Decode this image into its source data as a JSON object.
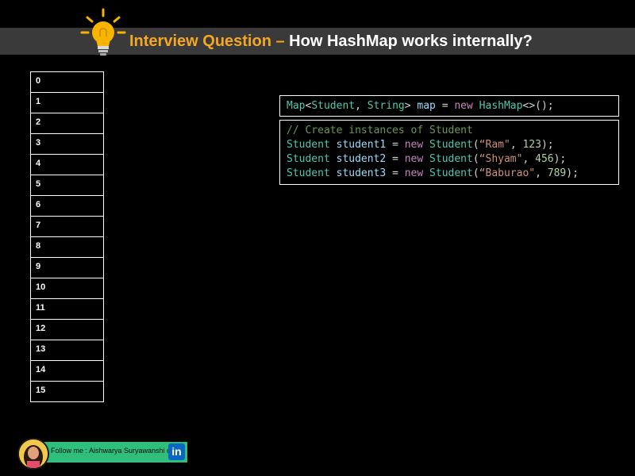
{
  "header": {
    "title_accent": "Interview Question –",
    "title_main": "How HashMap works internally?"
  },
  "buckets": [
    "0",
    "1",
    "2",
    "3",
    "4",
    "5",
    "6",
    "7",
    "8",
    "9",
    "10",
    "11",
    "12",
    "13",
    "14",
    "15"
  ],
  "code": {
    "map_decl": [
      {
        "t": "type",
        "v": "Map"
      },
      {
        "t": "op",
        "v": "<"
      },
      {
        "t": "type",
        "v": "Student"
      },
      {
        "t": "op",
        "v": ", "
      },
      {
        "t": "type",
        "v": "String"
      },
      {
        "t": "op",
        "v": "> "
      },
      {
        "t": "var",
        "v": "map"
      },
      {
        "t": "op",
        "v": " = "
      },
      {
        "t": "kw",
        "v": "new"
      },
      {
        "t": "op",
        "v": " "
      },
      {
        "t": "type",
        "v": "HashMap"
      },
      {
        "t": "op",
        "v": "<>();"
      }
    ],
    "comment": "// Create instances of Student",
    "students": [
      [
        {
          "t": "type",
          "v": "Student"
        },
        {
          "t": "op",
          "v": " "
        },
        {
          "t": "var",
          "v": "student1"
        },
        {
          "t": "op",
          "v": " = "
        },
        {
          "t": "kw",
          "v": "new"
        },
        {
          "t": "op",
          "v": " "
        },
        {
          "t": "type",
          "v": "Student"
        },
        {
          "t": "op",
          "v": "("
        },
        {
          "t": "str",
          "v": "“Ram\""
        },
        {
          "t": "op",
          "v": ", "
        },
        {
          "t": "num",
          "v": "123"
        },
        {
          "t": "op",
          "v": ");"
        }
      ],
      [
        {
          "t": "type",
          "v": "Student"
        },
        {
          "t": "op",
          "v": " "
        },
        {
          "t": "var",
          "v": "student2"
        },
        {
          "t": "op",
          "v": " = "
        },
        {
          "t": "kw",
          "v": "new"
        },
        {
          "t": "op",
          "v": " "
        },
        {
          "t": "type",
          "v": "Student"
        },
        {
          "t": "op",
          "v": "("
        },
        {
          "t": "str",
          "v": "“Shyam\""
        },
        {
          "t": "op",
          "v": ", "
        },
        {
          "t": "num",
          "v": "456"
        },
        {
          "t": "op",
          "v": ");"
        }
      ],
      [
        {
          "t": "type",
          "v": "Student"
        },
        {
          "t": "op",
          "v": " "
        },
        {
          "t": "var",
          "v": "student3"
        },
        {
          "t": "op",
          "v": " = "
        },
        {
          "t": "kw",
          "v": "new"
        },
        {
          "t": "op",
          "v": " "
        },
        {
          "t": "type",
          "v": "Student"
        },
        {
          "t": "op",
          "v": "("
        },
        {
          "t": "str",
          "v": "“Baburao\""
        },
        {
          "t": "op",
          "v": ", "
        },
        {
          "t": "num",
          "v": "789"
        },
        {
          "t": "op",
          "v": ");"
        }
      ]
    ]
  },
  "footer": {
    "follow_text": "Follow me : Aishwarya Suryawanshi on",
    "linkedin_label": "in"
  },
  "colors": {
    "accent": "#f5a623",
    "type": "#4ec9b0",
    "var": "#9cdcfe",
    "kw": "#c586c0",
    "str": "#ce9178",
    "num": "#b5cea8",
    "comment": "#6a9955",
    "follow_bar": "#2ebf7d",
    "linkedin": "#0a66c2"
  }
}
